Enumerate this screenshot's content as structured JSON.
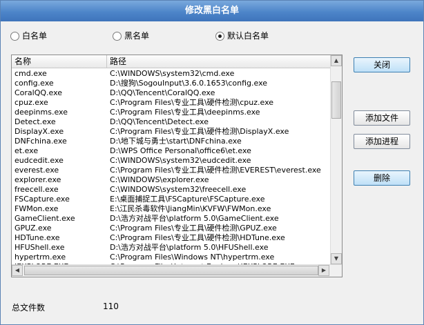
{
  "title": "修改黑白名单",
  "radios": [
    {
      "label": "白名单",
      "selected": false
    },
    {
      "label": "黑名单",
      "selected": false
    },
    {
      "label": "默认白名单",
      "selected": true
    }
  ],
  "columns": {
    "name": "名称",
    "path": "路径"
  },
  "rows": [
    {
      "name": "cmd.exe",
      "path": "C:\\WINDOWS\\system32\\cmd.exe"
    },
    {
      "name": "config.exe",
      "path": "D:\\搜狗\\SogouInput\\3.6.0.1653\\config.exe"
    },
    {
      "name": "CoralQQ.exe",
      "path": "D:\\QQ\\Tencent\\CoralQQ.exe"
    },
    {
      "name": "cpuz.exe",
      "path": "C:\\Program Files\\专业工具\\硬件检测\\cpuz.exe"
    },
    {
      "name": "deepinms.exe",
      "path": "C:\\Program Files\\专业工具\\deepinms.exe"
    },
    {
      "name": "Detect.exe",
      "path": "D:\\QQ\\Tencent\\Detect.exe"
    },
    {
      "name": "DisplayX.exe",
      "path": "C:\\Program Files\\专业工具\\硬件检测\\DisplayX.exe"
    },
    {
      "name": "DNFchina.exe",
      "path": "D:\\地下城与勇士\\start\\DNFchina.exe"
    },
    {
      "name": "et.exe",
      "path": "D:\\WPS Office Personal\\office6\\et.exe"
    },
    {
      "name": "eudcedit.exe",
      "path": "C:\\WINDOWS\\system32\\eudcedit.exe"
    },
    {
      "name": "everest.exe",
      "path": "C:\\Program Files\\专业工具\\硬件检测\\EVEREST\\everest.exe"
    },
    {
      "name": "explorer.exe",
      "path": "C:\\WINDOWS\\explorer.exe"
    },
    {
      "name": "freecell.exe",
      "path": "C:\\WINDOWS\\system32\\freecell.exe"
    },
    {
      "name": "FSCapture.exe",
      "path": "E:\\桌面捕捉工具\\FSCapture\\FSCapture.exe"
    },
    {
      "name": "FWMon.exe",
      "path": "E:\\江民杀毒软件\\JiangMin\\KVFW\\FWMon.exe"
    },
    {
      "name": "GameClient.exe",
      "path": "D:\\浩方对战平台\\platform 5.0\\GameClient.exe"
    },
    {
      "name": "GPUZ.exe",
      "path": "C:\\Program Files\\专业工具\\硬件检测\\GPUZ.exe"
    },
    {
      "name": "HDTune.exe",
      "path": "C:\\Program Files\\专业工具\\硬件检测\\HDTune.exe"
    },
    {
      "name": "HFUShell.exe",
      "path": "D:\\浩方对战平台\\platform 5.0\\HFUShell.exe"
    },
    {
      "name": "hypertrm.exe",
      "path": "C:\\Program Files\\Windows NT\\hypertrm.exe"
    },
    {
      "name": "IEXPLORE.EXE",
      "path": "C:\\Program Files\\Internet Explorer\\IEXPLORE.EXE"
    }
  ],
  "buttons": {
    "close": "关闭",
    "add_file": "添加文件",
    "add_process": "添加进程",
    "delete": "删除"
  },
  "footer": {
    "label": "总文件数",
    "count": "110"
  },
  "colors": {
    "title_bar": "#4d85c9",
    "accent_button": "#bfe0f7"
  }
}
